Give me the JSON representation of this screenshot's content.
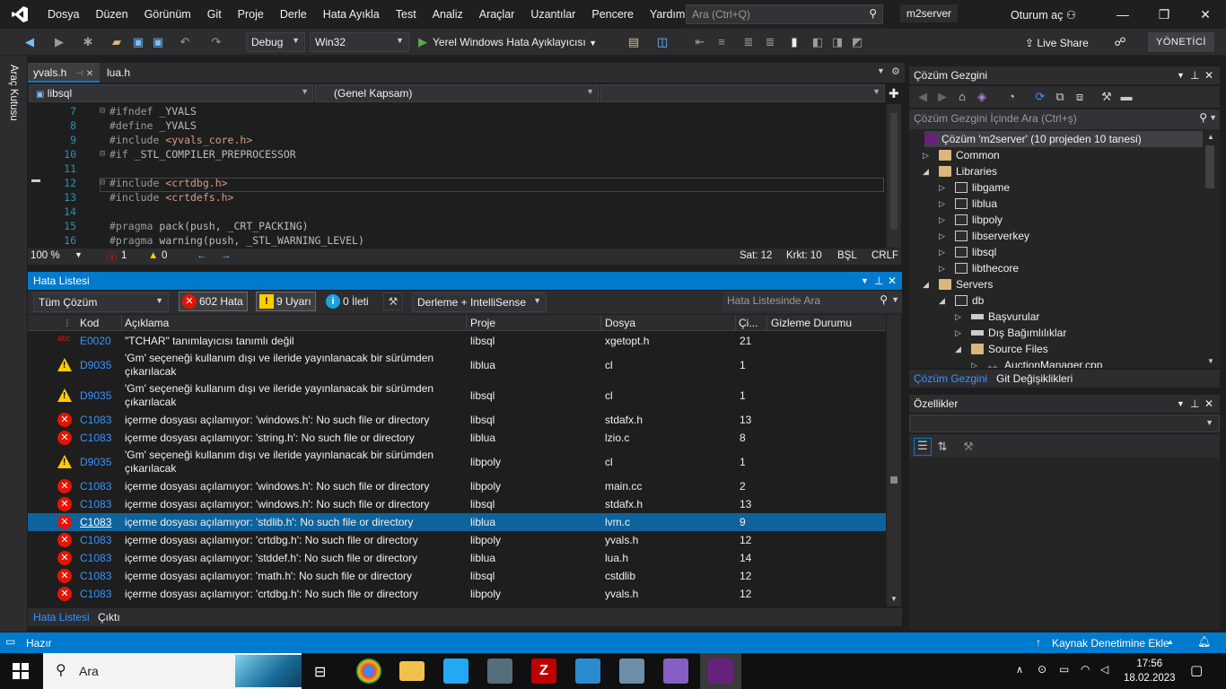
{
  "menu": [
    "Dosya",
    "Düzen",
    "Görünüm",
    "Git",
    "Proje",
    "Derle",
    "Hata Ayıkla",
    "Test",
    "Analiz",
    "Araçlar",
    "Uzantılar",
    "Pencere",
    "Yardım"
  ],
  "title_search_placeholder": "Ara (Ctrl+Q)",
  "solution_name": "m2server",
  "signin": "Oturum aç",
  "toolbar": {
    "config": "Debug",
    "platform": "Win32",
    "run_label": "Yerel Windows Hata Ayıklayıcısı",
    "live_share": "Live Share",
    "admin": "YÖNETİCİ"
  },
  "toolbox_label": "Araç Kutusu",
  "editor": {
    "tabs": [
      "yvals.h",
      "lua.h"
    ],
    "nav_project": "libsql",
    "nav_scope": "(Genel Kapsam)",
    "lines": [
      {
        "n": "7",
        "text": "#ifndef _YVALS",
        "fold": "⊟"
      },
      {
        "n": "8",
        "text": "#define _YVALS",
        "fold": ""
      },
      {
        "n": "9",
        "text": "#include <yvals_core.h>",
        "fold": ""
      },
      {
        "n": "10",
        "text": "#if _STL_COMPILER_PREPROCESSOR",
        "fold": "⊟"
      },
      {
        "n": "11",
        "text": "",
        "fold": ""
      },
      {
        "n": "12",
        "text": "#include <crtdbg.h>",
        "fold": "⊟"
      },
      {
        "n": "13",
        "text": "#include <crtdefs.h>",
        "fold": ""
      },
      {
        "n": "14",
        "text": "",
        "fold": ""
      },
      {
        "n": "15",
        "text": "#pragma pack(push, _CRT_PACKING)",
        "fold": ""
      },
      {
        "n": "16",
        "text": "#pragma warning(push, _STL_WARNING_LEVEL)",
        "fold": ""
      }
    ],
    "zoom": "100 %",
    "err_count": "1",
    "warn_count": "0",
    "line": "Sat: 12",
    "col": "Krkt: 10",
    "mode": "BŞL",
    "eol": "CRLF"
  },
  "error_list": {
    "title": "Hata Listesi",
    "scope": "Tüm Çözüm",
    "errors_btn": "602 Hata",
    "warnings_btn": "9 Uyarı",
    "messages_btn": "0 İleti",
    "source": "Derleme + IntelliSense",
    "search_placeholder": "Hata Listesinde Ara",
    "columns": [
      "Kod",
      "Açıklama",
      "Proje",
      "Dosya",
      "Çi...",
      "Gizleme Durumu"
    ],
    "rows": [
      {
        "sev": "abc",
        "code": "E0020",
        "desc": "\"TCHAR\" tanımlayıcısı tanımlı değil",
        "desc2": "",
        "proj": "libsql",
        "file": "xgetopt.h",
        "line": "21"
      },
      {
        "sev": "warn",
        "code": "D9035",
        "desc": "'Gm' seçeneği kullanım dışı ve ileride yayınlanacak bir sürümden",
        "desc2": "çıkarılacak",
        "proj": "liblua",
        "file": "cl",
        "line": "1"
      },
      {
        "sev": "warn",
        "code": "D9035",
        "desc": "'Gm' seçeneği kullanım dışı ve ileride yayınlanacak bir sürümden",
        "desc2": "çıkarılacak",
        "proj": "libsql",
        "file": "cl",
        "line": "1"
      },
      {
        "sev": "err",
        "code": "C1083",
        "desc": "içerme dosyası açılamıyor: 'windows.h': No such file or directory",
        "desc2": "",
        "proj": "libsql",
        "file": "stdafx.h",
        "line": "13"
      },
      {
        "sev": "err",
        "code": "C1083",
        "desc": "içerme dosyası açılamıyor: 'string.h': No such file or directory",
        "desc2": "",
        "proj": "liblua",
        "file": "lzio.c",
        "line": "8"
      },
      {
        "sev": "warn",
        "code": "D9035",
        "desc": "'Gm' seçeneği kullanım dışı ve ileride yayınlanacak bir sürümden",
        "desc2": "çıkarılacak",
        "proj": "libpoly",
        "file": "cl",
        "line": "1"
      },
      {
        "sev": "err",
        "code": "C1083",
        "desc": "içerme dosyası açılamıyor: 'windows.h': No such file or directory",
        "desc2": "",
        "proj": "libpoly",
        "file": "main.cc",
        "line": "2"
      },
      {
        "sev": "err",
        "code": "C1083",
        "desc": "içerme dosyası açılamıyor: 'windows.h': No such file or directory",
        "desc2": "",
        "proj": "libsql",
        "file": "stdafx.h",
        "line": "13"
      },
      {
        "sev": "err",
        "code": "C1083",
        "desc": "içerme dosyası açılamıyor: 'stdlib.h': No such file or directory",
        "desc2": "",
        "proj": "liblua",
        "file": "lvm.c",
        "line": "9"
      },
      {
        "sev": "err",
        "code": "C1083",
        "desc": "içerme dosyası açılamıyor: 'crtdbg.h': No such file or directory",
        "desc2": "",
        "proj": "libpoly",
        "file": "yvals.h",
        "line": "12"
      },
      {
        "sev": "err",
        "code": "C1083",
        "desc": "içerme dosyası açılamıyor: 'stddef.h': No such file or directory",
        "desc2": "",
        "proj": "liblua",
        "file": "lua.h",
        "line": "14"
      },
      {
        "sev": "err",
        "code": "C1083",
        "desc": "içerme dosyası açılamıyor: 'math.h': No such file or directory",
        "desc2": "",
        "proj": "libsql",
        "file": "cstdlib",
        "line": "12"
      },
      {
        "sev": "err",
        "code": "C1083",
        "desc": "içerme dosyası açılamıyor: 'crtdbg.h': No such file or directory",
        "desc2": "",
        "proj": "libpoly",
        "file": "yvals.h",
        "line": "12"
      }
    ],
    "tabs": [
      "Hata Listesi",
      "Çıktı"
    ]
  },
  "solution_explorer": {
    "title": "Çözüm Gezgini",
    "search_placeholder": "Çözüm Gezgini İçinde Ara (Ctrl+ş)",
    "tree": [
      {
        "label": "Çözüm 'm2server' (10 projeden 10 tanesi)",
        "level": 0,
        "icon": "sol",
        "exp": ""
      },
      {
        "label": "Common",
        "level": 1,
        "icon": "folder",
        "exp": "▷"
      },
      {
        "label": "Libraries",
        "level": 1,
        "icon": "folder",
        "exp": "◢"
      },
      {
        "label": "libgame",
        "level": 2,
        "icon": "proj",
        "exp": "▷"
      },
      {
        "label": "liblua",
        "level": 2,
        "icon": "proj",
        "exp": "▷"
      },
      {
        "label": "libpoly",
        "level": 2,
        "icon": "proj",
        "exp": "▷"
      },
      {
        "label": "libserverkey",
        "level": 2,
        "icon": "proj",
        "exp": "▷"
      },
      {
        "label": "libsql",
        "level": 2,
        "icon": "proj",
        "exp": "▷"
      },
      {
        "label": "libthecore",
        "level": 2,
        "icon": "proj",
        "exp": "▷"
      },
      {
        "label": "Servers",
        "level": 1,
        "icon": "folder",
        "exp": "◢"
      },
      {
        "label": "db",
        "level": 2,
        "icon": "proj",
        "exp": "◢"
      },
      {
        "label": "Başvurular",
        "level": 3,
        "icon": "ref",
        "exp": "▷"
      },
      {
        "label": "Dış Bağımlılıklar",
        "level": 3,
        "icon": "ref",
        "exp": "▷"
      },
      {
        "label": "Source Files",
        "level": 3,
        "icon": "folder",
        "exp": "◢"
      },
      {
        "label": "AuctionManager.cpp",
        "level": 4,
        "icon": "cpp",
        "exp": "▷"
      }
    ],
    "tabs": [
      "Çözüm Gezgini",
      "Git Değişiklikleri"
    ]
  },
  "properties": {
    "title": "Özellikler"
  },
  "status": {
    "ready": "Hazır",
    "source_control": "Kaynak Denetimine Ekle"
  },
  "taskbar": {
    "search": "Ara",
    "time": "17:56",
    "date": "18.02.2023"
  }
}
